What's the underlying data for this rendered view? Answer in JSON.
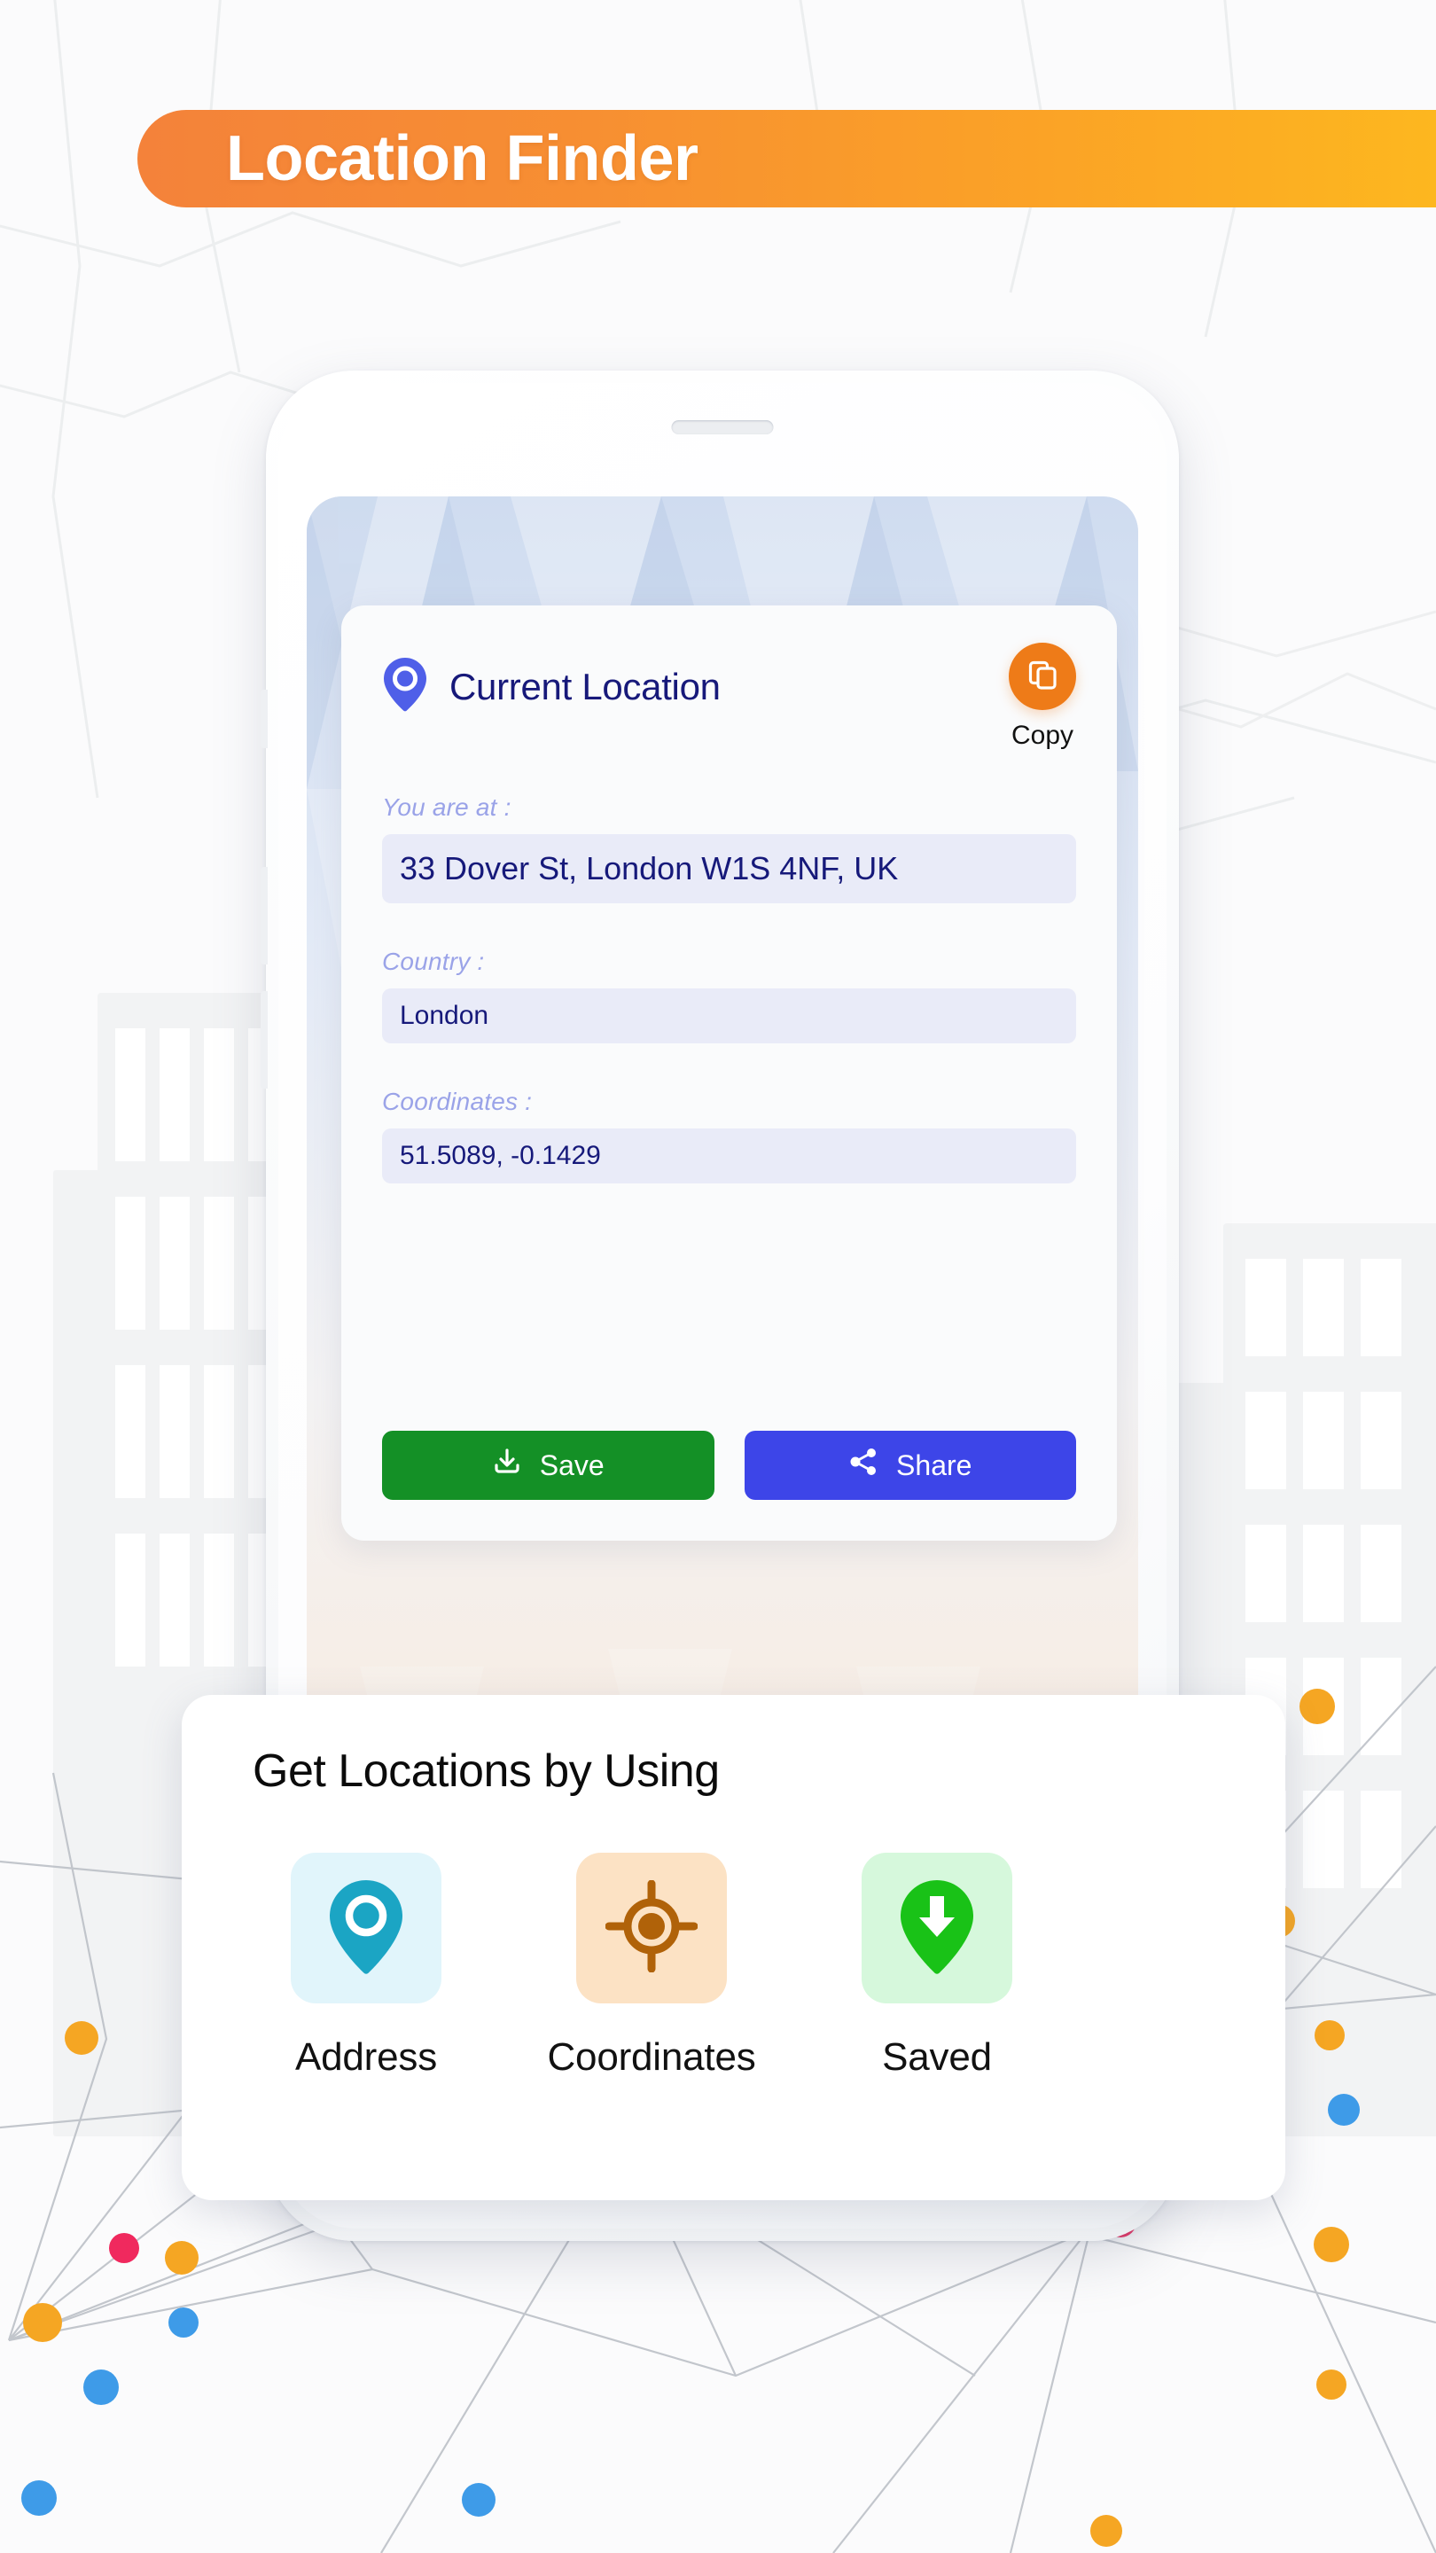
{
  "header": {
    "title": "Location Finder",
    "gradient_from": "#F4823A",
    "gradient_to": "#FDB71F"
  },
  "location_card": {
    "title": "Current Location",
    "pin_icon": "map-pin-icon",
    "pin_color": "#4F5FE8",
    "copy": {
      "label": "Copy",
      "icon": "copy-icon",
      "color": "#EE7B18"
    },
    "fields": [
      {
        "label": "You are at :",
        "value": "33 Dover St, London W1S 4NF, UK"
      },
      {
        "label": "Country :",
        "value": "London"
      },
      {
        "label": "Coordinates :",
        "value": "51.5089, -0.1429"
      }
    ],
    "actions": [
      {
        "label": "Save",
        "icon": "download-icon",
        "color": "#149026"
      },
      {
        "label": "Share",
        "icon": "share-icon",
        "color": "#3D45E8"
      }
    ]
  },
  "methods_card": {
    "title": "Get Locations by Using",
    "items": [
      {
        "label": "Address",
        "icon": "map-pin-icon",
        "tile_bg": "#E1F5FB",
        "icon_color": "#1BA5C4"
      },
      {
        "label": "Coordinates",
        "icon": "crosshair-icon",
        "tile_bg": "#FCE2C4",
        "icon_color": "#B06209"
      },
      {
        "label": "Saved",
        "icon": "pin-download-icon",
        "tile_bg": "#D6F8DC",
        "icon_color": "#19C217"
      }
    ]
  },
  "decor": {
    "dot_orange": "#F5A623",
    "dot_pink": "#F0295E",
    "dot_blue": "#3E9BE8",
    "line_color": "#B9BDC4"
  }
}
